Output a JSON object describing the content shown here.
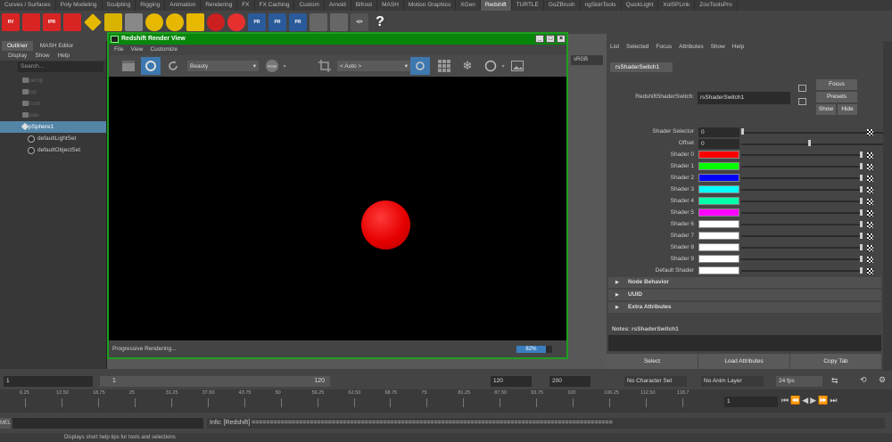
{
  "shelf_tabs": [
    "Curves / Surfaces",
    "Poly Modeling",
    "Sculpting",
    "Rigging",
    "Animation",
    "Rendering",
    "FX",
    "FX Caching",
    "Custom",
    "Arnold",
    "Bifrost",
    "MASH",
    "Motion Graphics",
    "XGen",
    "Redshift",
    "TURTLE",
    "GoZBrush",
    "ngSkinTools",
    "QuickLight",
    "XolSPLink",
    "ZooToolsPro"
  ],
  "active_shelf_tab": "Redshift",
  "shelf_icon_labels": {
    "rv": "RV",
    "ipr": "IPR",
    "pr": "PR",
    "help": "?"
  },
  "outliner": {
    "tabs": [
      "Outliner",
      "MASH Editor"
    ],
    "menu": [
      "Display",
      "Show",
      "Help"
    ],
    "search_placeholder": "Search...",
    "items": [
      {
        "label": "persp"
      },
      {
        "label": "top"
      },
      {
        "label": "front"
      },
      {
        "label": "side"
      },
      {
        "label": "pSphere1"
      },
      {
        "label": "defaultLightSet"
      },
      {
        "label": "defaultObjectSet"
      }
    ]
  },
  "render_view": {
    "title": "Redshift Render View",
    "menu": [
      "File",
      "View",
      "Customize"
    ],
    "aov_select": "Beauty",
    "rgb_label": "RGB",
    "zoom_select": "< Auto >",
    "srgb_label": "sRGB",
    "status": "Progressive Rendering...",
    "progress_percent": 82,
    "progress_label": "82%"
  },
  "attribute_editor": {
    "menu": [
      "List",
      "Selected",
      "Focus",
      "Attributes",
      "Show",
      "Help"
    ],
    "tab": "rsShaderSwitch1",
    "node_label": "RedshiftShaderSwitch:",
    "node_value": "rsShaderSwitch1",
    "focus": "Focus",
    "presets": "Presets",
    "show": "Show",
    "hide": "Hide",
    "selector_label": "Shader Selector",
    "selector_value": "0",
    "offset_label": "Offset",
    "offset_value": "0",
    "shaders": [
      {
        "label": "Shader 0",
        "color": "#ff0000"
      },
      {
        "label": "Shader 1",
        "color": "#00ff00"
      },
      {
        "label": "Shader 2",
        "color": "#0000ff"
      },
      {
        "label": "Shader 3",
        "color": "#00ffff"
      },
      {
        "label": "Shader 4",
        "color": "#00ffaa"
      },
      {
        "label": "Shader 5",
        "color": "#ff00ff"
      },
      {
        "label": "Shader 6",
        "color": "#ffffff"
      },
      {
        "label": "Shader 7",
        "color": "#ffffff"
      },
      {
        "label": "Shader 8",
        "color": "#ffffff"
      },
      {
        "label": "Shader 9",
        "color": "#ffffff"
      },
      {
        "label": "Default Shader",
        "color": "#ffffff"
      }
    ],
    "sections": [
      "Node Behavior",
      "UUID",
      "Extra Attributes"
    ],
    "notes_label": "Notes:  rsShaderSwitch1",
    "bottom_buttons": [
      "Select",
      "Load Attributes",
      "Copy Tab"
    ]
  },
  "time_ruler": {
    "ticks": [
      "6.25",
      "12.50",
      "18.75",
      "25",
      "31.25",
      "37.50",
      "43.75",
      "50",
      "56.25",
      "62.50",
      "68.75",
      "75",
      "81.25",
      "87.50",
      "93.75",
      "100",
      "106.25",
      "112.50",
      "118.7"
    ],
    "current_frame": "1"
  },
  "range_bar": {
    "start": "1",
    "inner_start": "1",
    "inner_end": "120",
    "end_a": "120",
    "end_b": "200",
    "character_set": "No Character Set",
    "anim_layer": "No Anim Layer",
    "fps": "24 fps"
  },
  "command_line": {
    "mode": "MEL",
    "info": "Info:  [Redshift] ==================================================================================================="
  },
  "help_line": "Displays short help tips for tools and selections"
}
